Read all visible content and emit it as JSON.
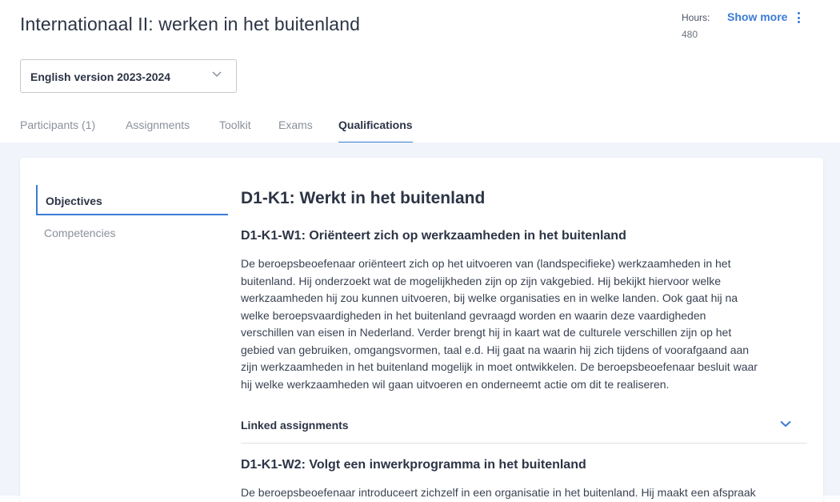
{
  "header": {
    "title": "Internationaal II: werken in het buitenland",
    "hours_label": "Hours:",
    "hours_value": "480",
    "show_more": "Show more"
  },
  "version_select": {
    "selected": "English version 2023-2024"
  },
  "tabs": [
    {
      "label": "Participants (1)",
      "active": false
    },
    {
      "label": "Assignments",
      "active": false
    },
    {
      "label": "Toolkit",
      "active": false
    },
    {
      "label": "Exams",
      "active": false
    },
    {
      "label": "Qualifications",
      "active": true
    }
  ],
  "side_nav": [
    {
      "label": "Objectives",
      "active": true
    },
    {
      "label": "Competencies",
      "active": false
    }
  ],
  "main": {
    "heading": "D1-K1: Werkt in het buitenland",
    "sections": [
      {
        "title": "D1-K1-W1: Oriënteert zich op werkzaamheden in het buitenland",
        "lines": [
          "De beroepsbeoefenaar oriënteert zich op het uitvoeren van (landspecifieke) werkzaamheden in het",
          "buitenland. Hij onderzoekt wat de mogelijkheden zijn op zijn vakgebied. Hij bekijkt hiervoor welke",
          "werkzaamheden hij zou kunnen uitvoeren, bij welke organisaties en in welke landen. Ook gaat hij na",
          "welke beroepsvaardigheden in het buitenland gevraagd worden en waarin deze vaardigheden",
          "verschillen van eisen in Nederland. Verder brengt hij in kaart wat de culturele verschillen zijn op het",
          "gebied van gebruiken, omgangsvormen, taal e.d. Hij gaat na waarin hij zich tijdens of voorafgaand aan",
          "zijn werkzaamheden in het buitenland mogelijk in moet ontwikkelen. De beroepsbeoefenaar besluit waar",
          "hij welke werkzaamheden wil gaan uitvoeren en onderneemt actie om dit te realiseren."
        ],
        "linked_label": "Linked assignments"
      },
      {
        "title": "D1-K1-W2: Volgt een inwerkprogramma in het buitenland",
        "lines": [
          "De beroepsbeoefenaar introduceert zichzelf in een organisatie in het buitenland. Hij maakt een afspraak"
        ]
      }
    ]
  },
  "colors": {
    "accent": "#3b7bd4",
    "text": "#2c3445",
    "muted": "#8a919c",
    "background": "#f1f4fa"
  },
  "icons": {
    "select_chevron": "chevron-down-icon",
    "linked_chevron": "chevron-down-icon",
    "menu": "kebab-menu-icon"
  }
}
